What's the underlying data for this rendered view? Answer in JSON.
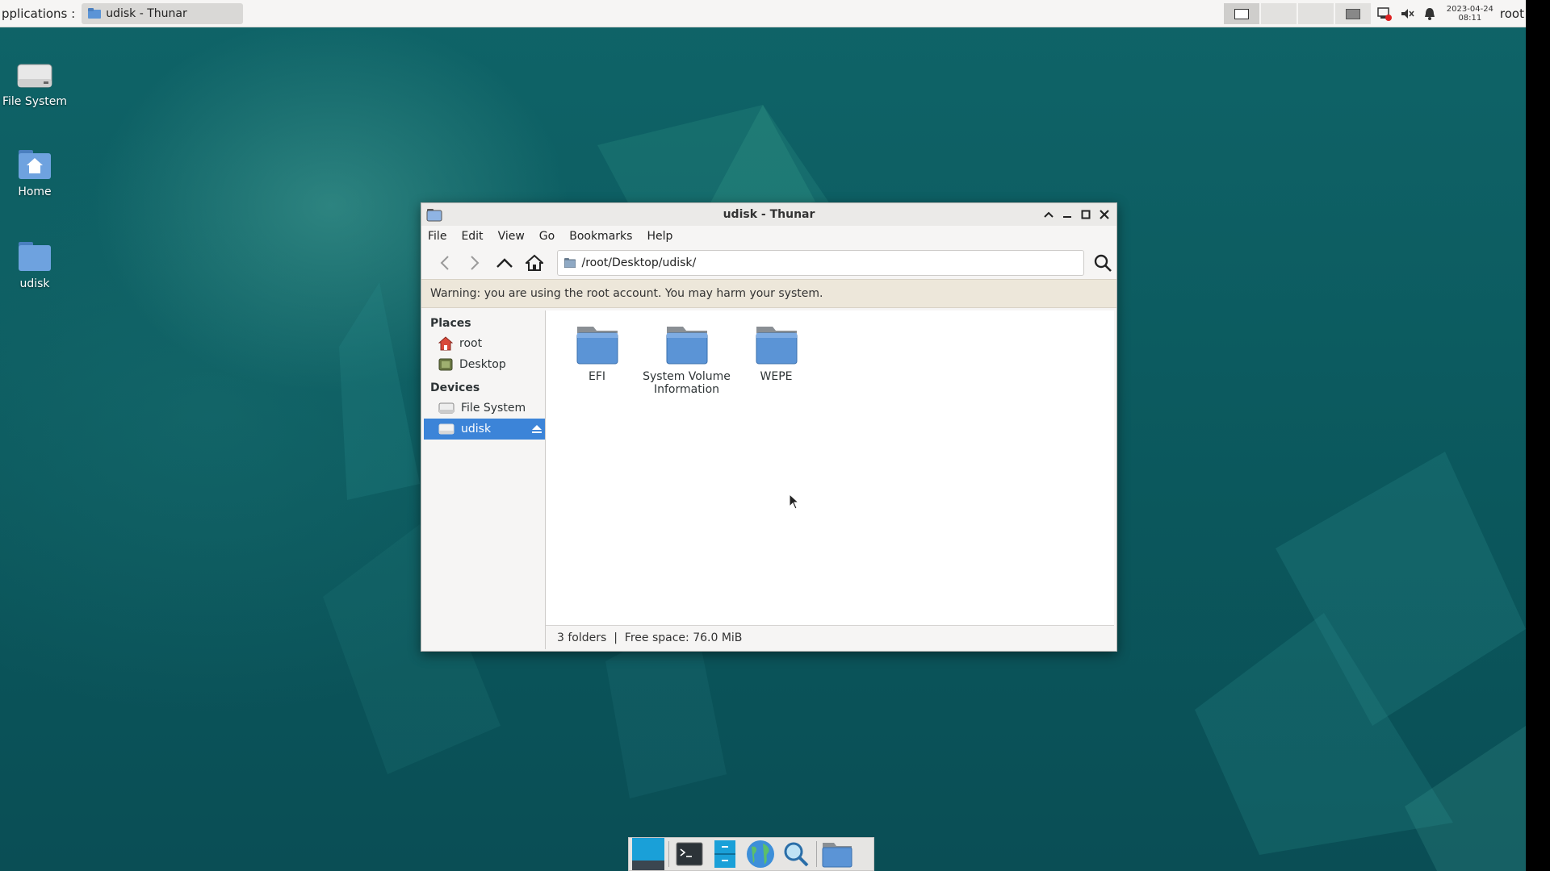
{
  "panel": {
    "apps_menu": "pplications :",
    "task_title": "udisk - Thunar",
    "clock_date": "2023-04-24",
    "clock_time": "08:11",
    "user": "root"
  },
  "desktop_icons": [
    {
      "label": "File System"
    },
    {
      "label": "Home"
    },
    {
      "label": "udisk"
    }
  ],
  "window": {
    "title": "udisk - Thunar",
    "menu": [
      "File",
      "Edit",
      "View",
      "Go",
      "Bookmarks",
      "Help"
    ],
    "path": "/root/Desktop/udisk/",
    "warning": "Warning: you are using the root account. You may harm your system.",
    "sidebar": {
      "places_heading": "Places",
      "places": [
        "root",
        "Desktop"
      ],
      "devices_heading": "Devices",
      "devices": [
        "File System",
        "udisk"
      ],
      "selected": "udisk"
    },
    "files": [
      {
        "name": "EFI"
      },
      {
        "name": "System Volume Information"
      },
      {
        "name": "WEPE"
      }
    ],
    "status": "3 folders  |  Free space: 76.0 MiB"
  },
  "colors": {
    "selection": "#3c84d8",
    "folder": "#5b94d6",
    "desktop": "#0d5d62"
  }
}
